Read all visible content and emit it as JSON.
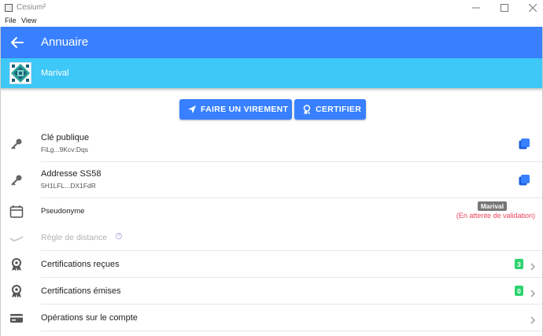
{
  "window": {
    "title": "Cesium²",
    "controls": [
      "minimize",
      "maximize",
      "close"
    ]
  },
  "menu": {
    "file": "File",
    "view": "View"
  },
  "header": {
    "title": "Annuaire",
    "back_icon": "arrow-left-icon",
    "color": "#3880ff"
  },
  "subheader": {
    "name": "Marival",
    "color": "#3ec8f8"
  },
  "actions": {
    "transfer_label": "FAIRE UN VIREMENT",
    "certify_label": "CERTIFIER"
  },
  "rows": {
    "public_key": {
      "label": "Clé publique",
      "value": "FiLg...9Kcv:Dqs"
    },
    "ss58": {
      "label": "Addresse SS58",
      "value": "5H1LFL...DX1FdR"
    },
    "pseudonym": {
      "label": "Pseudonyme",
      "tag": "Marival",
      "status": "(En attente de validation)",
      "status_color": "#eb445a"
    },
    "distance_rule": {
      "label": "Règle de distance"
    },
    "certs_received": {
      "label": "Certifications reçues",
      "count": "3"
    },
    "certs_issued": {
      "label": "Certifications émises",
      "count": "0"
    },
    "operations": {
      "label": "Opérations sur le compte"
    }
  },
  "colors": {
    "accent": "#3880ff",
    "success": "#2dd36f",
    "danger": "#eb445a"
  }
}
